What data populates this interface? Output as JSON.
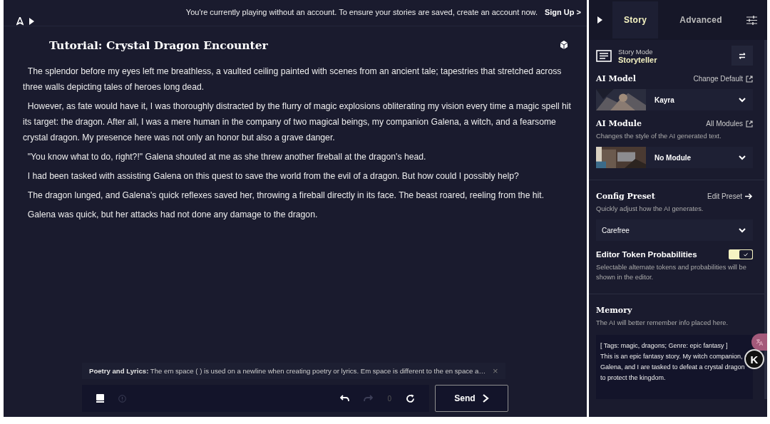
{
  "banner": {
    "text": "You're currently playing without an account. To ensure your stories are saved, create an account now.",
    "link": "Sign Up >"
  },
  "story": {
    "title": "Tutorial: Crystal Dragon Encounter",
    "paragraphs": [
      "  The splendor before my eyes left me breathless, a vaulted ceiling painted with scenes from an ancient tale; tapestries that stretched across three walls depicting tales of heroes long dead.",
      "  However, as fate would have it, I was thoroughly distracted by the flurry of magic explosions obliterating my vision every time a magic spell hit its target: the dragon. After all, I was a mere human in the company of two magical beings, my companion Galena, a witch, and a fearsome crystal dragon. My presence here was not only an honor but also a grave danger.",
      "  \"You know what to do, right?!\" Galena shouted at me as she threw another fireball at the dragon's head.",
      "  I had been tasked with assisting Galena on this quest to save the world from the evil of a dragon. But how could I possibly help?",
      "  The dragon lunged, and Galena's quick reflexes saved her, throwing a fireball directly in its face. The beast roared, reeling from the hit.",
      "  Galena was quick, but her attacks had not done any damage to the dragon."
    ]
  },
  "tip": {
    "text": "**Poetry and Lyrics:** The em space (   ) is used on a newline when creating poetry or lyrics. Em space is different to the en space a…",
    "close": "×"
  },
  "toolbar": {
    "counter": "0",
    "send": "Send"
  },
  "sidebar": {
    "tabs": [
      {
        "label": "Story",
        "selected": true
      },
      {
        "label": "Advanced",
        "selected": false
      }
    ],
    "story_mode": {
      "label": "Story Mode",
      "value": "Storyteller"
    },
    "ai_model": {
      "title": "AI Model",
      "link": "Change Default",
      "value": "Kayra"
    },
    "ai_module": {
      "title": "AI Module",
      "link": "All Modules",
      "description": "Changes the style of the AI generated text.",
      "value": "No Module"
    },
    "config_preset": {
      "title": "Config Preset",
      "link": "Edit Preset",
      "description": "Quickly adjust how the AI generates.",
      "value": "Carefree"
    },
    "token_probabilities": {
      "title": "Editor Token Probabilities",
      "on": true,
      "description": "Selectable alternate tokens and probabilities will be shown in the editor."
    },
    "memory": {
      "title": "Memory",
      "description": "The AI will better remember info placed here.",
      "value": "[ Tags: magic, dragons; Genre: epic fantasy ]\nThis is an epic fantasy story. My witch companion, Galena, and I are tasked to defeat a crystal dragon to protect the kingdom."
    }
  },
  "floating_badge": {
    "letter": "K"
  }
}
